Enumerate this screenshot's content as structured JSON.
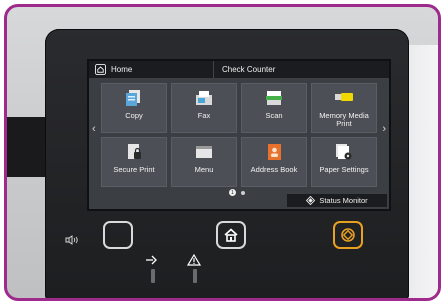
{
  "screen": {
    "home_label": "Home",
    "check_counter_label": "Check Counter",
    "tiles": [
      {
        "label": "Copy",
        "icon": "copy-icon"
      },
      {
        "label": "Fax",
        "icon": "fax-icon"
      },
      {
        "label": "Scan",
        "icon": "scan-icon"
      },
      {
        "label": "Memory Media Print",
        "icon": "memory-media-icon"
      },
      {
        "label": "Secure Print",
        "icon": "secure-print-icon"
      },
      {
        "label": "Menu",
        "icon": "menu-icon"
      },
      {
        "label": "Address Book",
        "icon": "address-book-icon"
      },
      {
        "label": "Paper Settings",
        "icon": "paper-settings-icon"
      }
    ],
    "page_indicator": "1",
    "status_monitor_label": "Status Monitor"
  },
  "colors": {
    "frame": "#9e2a8c",
    "stop_button": "#e8a020"
  }
}
